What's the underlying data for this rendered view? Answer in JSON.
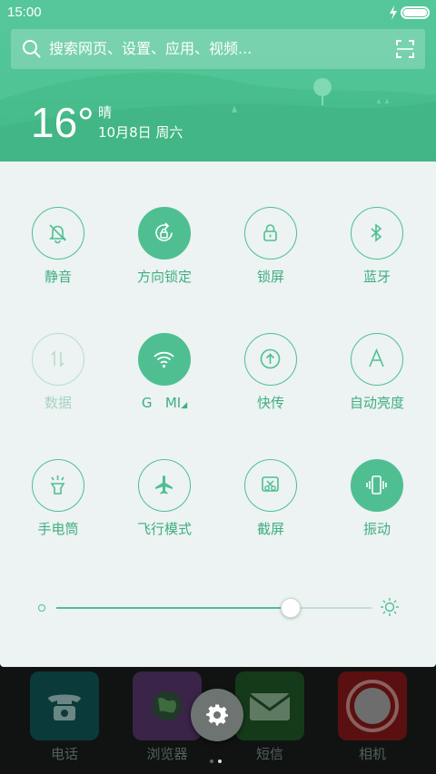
{
  "status_bar": {
    "time": "15:00",
    "battery_level": 1.0
  },
  "search": {
    "placeholder": "搜索网页、设置、应用、视频..."
  },
  "weather": {
    "temperature": "16°",
    "condition": "晴",
    "date": "10月8日 周六"
  },
  "colors": {
    "accent": "#4fbf92",
    "header": "#50c495",
    "panel": "#ecf3f2"
  },
  "toggles": [
    {
      "label": "静音",
      "icon": "bell-off-icon",
      "state": "off"
    },
    {
      "label": "方向锁定",
      "icon": "rotation-lock-icon",
      "state": "on"
    },
    {
      "label": "锁屏",
      "icon": "lock-icon",
      "state": "off"
    },
    {
      "label": "蓝牙",
      "icon": "bluetooth-icon",
      "state": "off"
    },
    {
      "label": "数据",
      "icon": "mobile-data-icon",
      "state": "disabled"
    },
    {
      "label": "G   MI",
      "icon": "wifi-icon",
      "state": "on"
    },
    {
      "label": "快传",
      "icon": "quick-share-icon",
      "state": "off"
    },
    {
      "label": "自动亮度",
      "icon": "auto-brightness-icon",
      "state": "off"
    },
    {
      "label": "手电筒",
      "icon": "flashlight-icon",
      "state": "off"
    },
    {
      "label": "飞行模式",
      "icon": "airplane-icon",
      "state": "off"
    },
    {
      "label": "截屏",
      "icon": "screenshot-icon",
      "state": "off"
    },
    {
      "label": "振动",
      "icon": "vibrate-icon",
      "state": "on"
    }
  ],
  "brightness": {
    "value": 0.74
  },
  "dock": {
    "apps": [
      {
        "label": "电话",
        "icon": "phone-icon",
        "color": "#0b3a3a"
      },
      {
        "label": "浏览器",
        "icon": "globe-icon",
        "color": "#3a2447"
      },
      {
        "label": "短信",
        "icon": "message-icon",
        "color": "#153a1a"
      },
      {
        "label": "相机",
        "icon": "camera-icon",
        "color": "#5a1010"
      }
    ],
    "page_indicator": {
      "pages": 2,
      "current": 2
    }
  }
}
